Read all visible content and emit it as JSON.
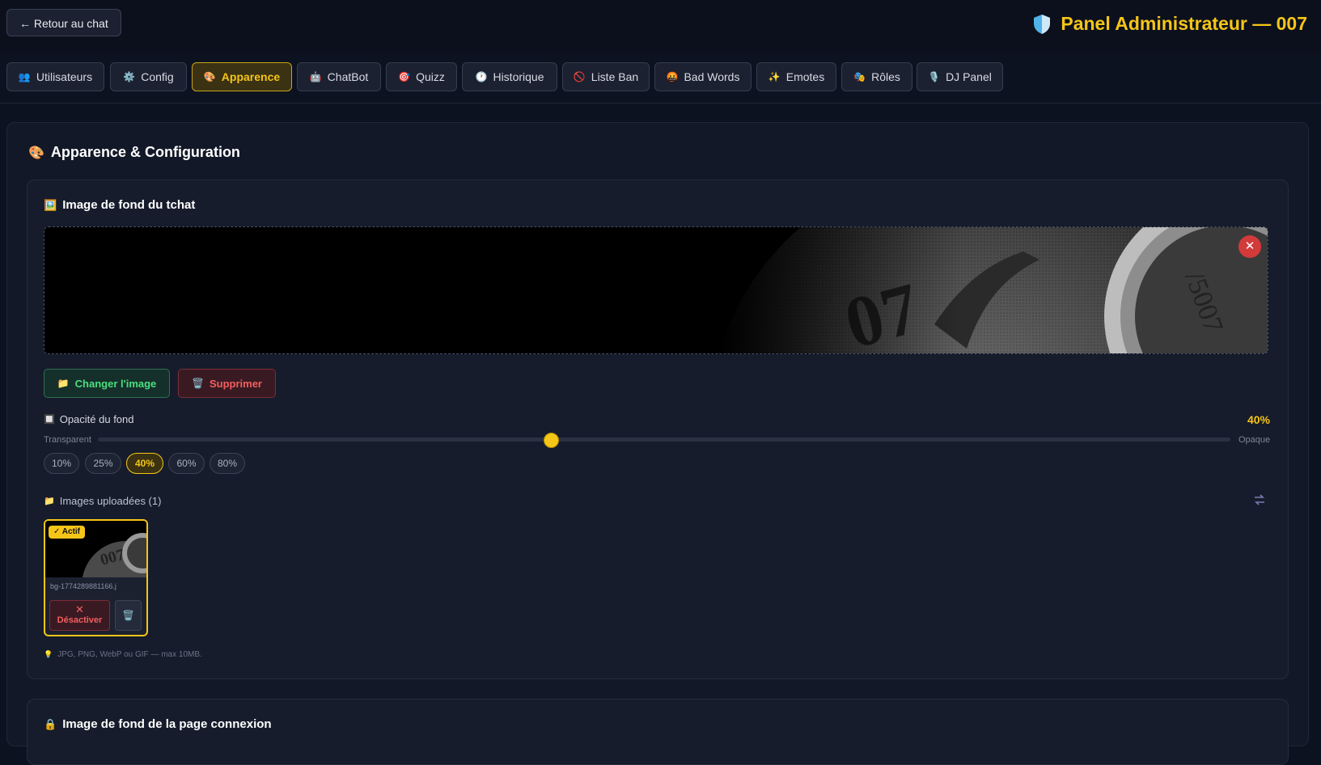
{
  "header": {
    "back_label": "← Retour au chat",
    "title": "Panel Administrateur — 007",
    "title_icon": "shield-icon",
    "accent_color": "#f5c518"
  },
  "tabs": [
    {
      "label": "Utilisateurs",
      "icon": "👥",
      "active": false
    },
    {
      "label": "Config",
      "icon": "⚙️",
      "active": false
    },
    {
      "label": "Apparence",
      "icon": "🎨",
      "active": true
    },
    {
      "label": "ChatBot",
      "icon": "🤖",
      "active": false
    },
    {
      "label": "Quizz",
      "icon": "🎯",
      "active": false
    },
    {
      "label": "Historique",
      "icon": "🕐",
      "active": false
    },
    {
      "label": "Liste Ban",
      "icon": "🚫",
      "active": false
    },
    {
      "label": "Bad Words",
      "icon": "🤬",
      "active": false
    },
    {
      "label": "Emotes",
      "icon": "✨",
      "active": false
    },
    {
      "label": "Rôles",
      "icon": "🎭",
      "active": false
    },
    {
      "label": "DJ Panel",
      "icon": "🎙️",
      "active": false
    }
  ],
  "section": {
    "title": "Apparence & Configuration",
    "icon": "🎨"
  },
  "chat_background": {
    "title": "Image de fond du tchat",
    "icon": "🖼️",
    "change_label": "Changer l'image",
    "change_icon": "📁",
    "delete_label": "Supprimer",
    "delete_icon": "🗑️",
    "opacity": {
      "label": "Opacité du fond",
      "icon": "🔲",
      "value": 40,
      "value_label": "40%",
      "min_label": "Transparent",
      "max_label": "Opaque",
      "presets": [
        "10%",
        "25%",
        "40%",
        "60%",
        "80%"
      ],
      "active_preset": "40%"
    },
    "uploads": {
      "label": "Images uploadées (1)",
      "icon": "📁",
      "items": [
        {
          "filename": "bg-1774289881166.j",
          "badge": "✓ Actif",
          "deactivate_label": "Désactiver",
          "deactivate_icon": "✕",
          "trash_icon": "🗑️"
        }
      ]
    },
    "hint": "JPG, PNG, WebP ou GIF — max 10MB.",
    "hint_icon": "💡"
  },
  "login_background": {
    "title": "Image de fond de la page connexion",
    "icon": "🔒"
  }
}
